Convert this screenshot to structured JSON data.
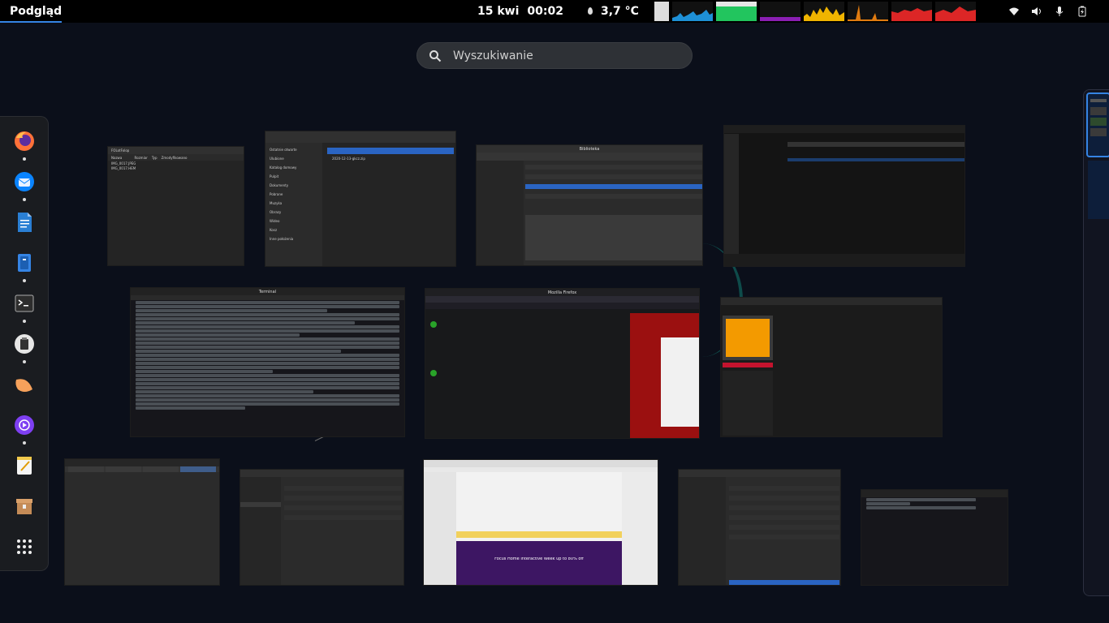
{
  "topbar": {
    "activities_label": "Podgląd",
    "date": "15 kwi",
    "time": "00:02",
    "temperature": "3,7 °C",
    "graph_colors": [
      "#1e90d6",
      "#22c55e",
      "#8b1fb3",
      "#f0b400",
      "#e07b10",
      "#dc2626",
      "#dc2626"
    ]
  },
  "search": {
    "placeholder": "Wyszukiwanie"
  },
  "dash": {
    "apps": [
      {
        "icon": "firefox-icon",
        "running": true
      },
      {
        "icon": "thunderbird-icon",
        "running": true
      },
      {
        "icon": "libreoffice-writer-icon",
        "running": false
      },
      {
        "icon": "file-manager-icon",
        "running": true
      },
      {
        "icon": "terminal-icon",
        "running": true
      },
      {
        "icon": "clipboard-icon",
        "running": true
      },
      {
        "icon": "weather-icon",
        "running": false
      },
      {
        "icon": "podcast-icon",
        "running": true
      },
      {
        "icon": "text-editor-icon",
        "running": false
      },
      {
        "icon": "archive-icon",
        "running": false
      },
      {
        "icon": "app-grid-icon",
        "running": false
      }
    ]
  },
  "windows": {
    "files1_path": "FOLotFolop",
    "files1_items": [
      "IMG_0017.JPEG",
      "IMG_0017.HEM"
    ],
    "files2_item": "2020-12-13-gkcz.zip",
    "bookmarks_title": "Biblioteka",
    "terminal_title": "Terminal",
    "firefox_title": "Mozilla Firefox",
    "thunderbird_banner": "Focus Home Interactive Week up to 80% off",
    "nautilus_sidebar": [
      "Ostatnie otwarte",
      "Ulubione",
      "Katalog domowy",
      "Pulpit",
      "Dokumenty",
      "Pobrane",
      "Muzyka",
      "Obrazy",
      "Wideo",
      "Kosz",
      "Inne położenia"
    ]
  }
}
